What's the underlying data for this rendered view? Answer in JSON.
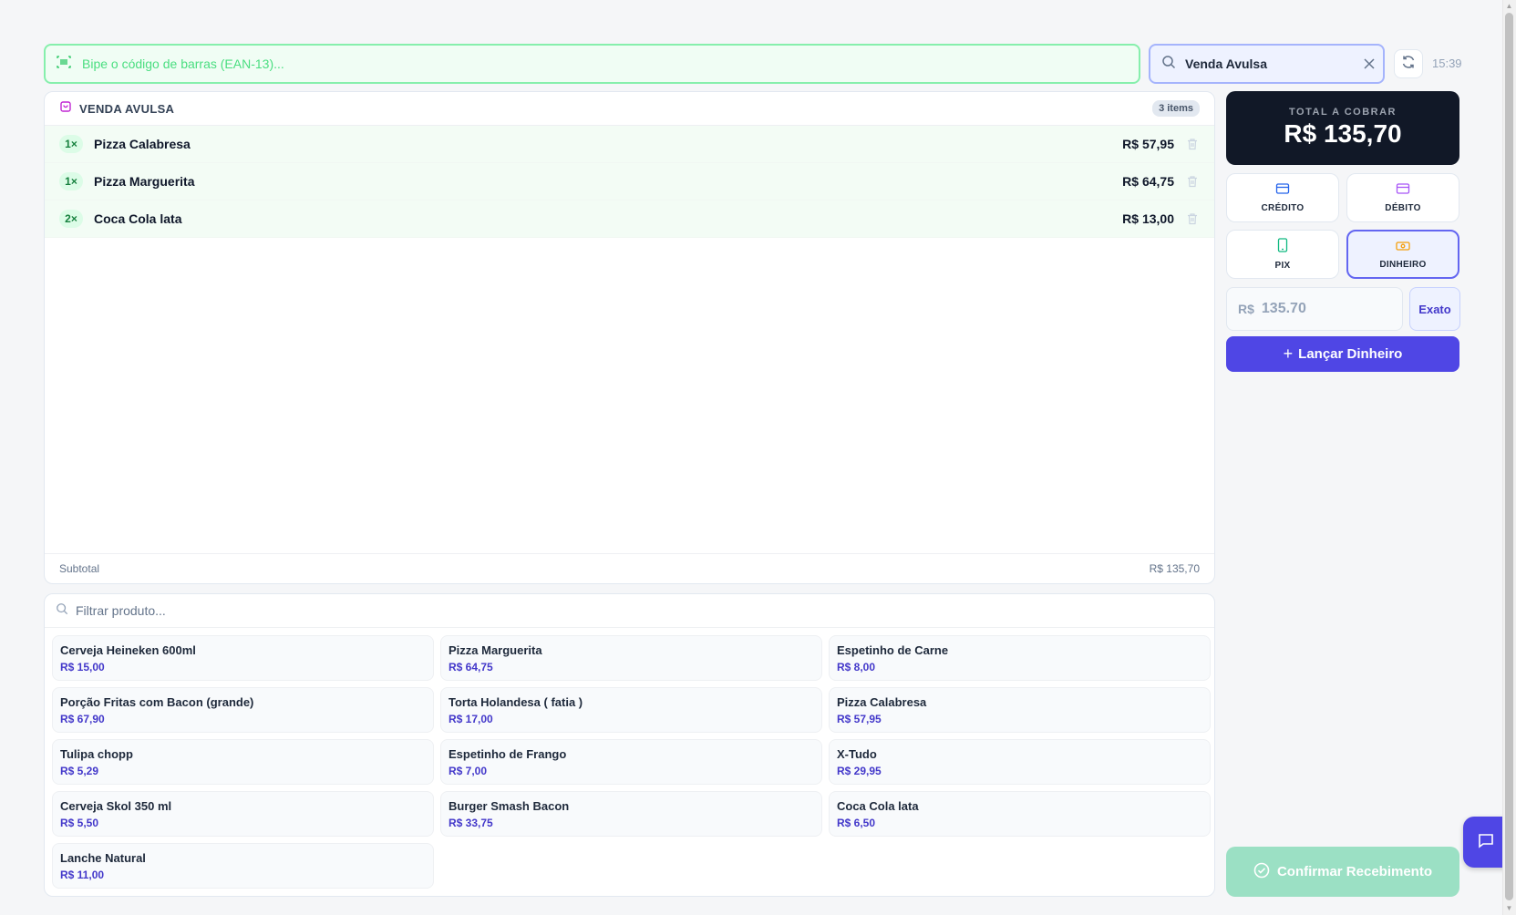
{
  "barcode": {
    "placeholder": "Bipe o código de barras (EAN-13)...",
    "icon": "barcode-scan-icon"
  },
  "client": {
    "value": "Venda Avulsa",
    "icon": "search-icon"
  },
  "clock": "15:39",
  "cart": {
    "title": "VENDA AVULSA",
    "count_label": "3 items",
    "items": [
      {
        "qty": "1×",
        "name": "Pizza Calabresa",
        "price": "R$ 57,95"
      },
      {
        "qty": "1×",
        "name": "Pizza Marguerita",
        "price": "R$ 64,75"
      },
      {
        "qty": "2×",
        "name": "Coca Cola lata",
        "price": "R$ 13,00"
      }
    ],
    "subtotal_label": "Subtotal",
    "subtotal_value": "R$ 135,70"
  },
  "products": {
    "filter_placeholder": "Filtrar produto...",
    "items": [
      {
        "name": "Cerveja Heineken 600ml",
        "price": "R$ 15,00"
      },
      {
        "name": "Pizza Marguerita",
        "price": "R$ 64,75"
      },
      {
        "name": "Espetinho de Carne",
        "price": "R$ 8,00"
      },
      {
        "name": "Porção Fritas com Bacon (grande)",
        "price": "R$ 67,90"
      },
      {
        "name": "Torta Holandesa ( fatia )",
        "price": "R$ 17,00"
      },
      {
        "name": "Pizza Calabresa",
        "price": "R$ 57,95"
      },
      {
        "name": "Tulipa chopp",
        "price": "R$ 5,29"
      },
      {
        "name": "Espetinho de Frango",
        "price": "R$ 7,00"
      },
      {
        "name": "X-Tudo",
        "price": "R$ 29,95"
      },
      {
        "name": "Cerveja Skol 350 ml",
        "price": "R$ 5,50"
      },
      {
        "name": "Burger Smash Bacon",
        "price": "R$ 33,75"
      },
      {
        "name": "Coca Cola lata",
        "price": "R$ 6,50"
      },
      {
        "name": "Lanche Natural",
        "price": "R$ 11,00"
      }
    ]
  },
  "total": {
    "label": "TOTAL A COBRAR",
    "amount": "R$ 135,70"
  },
  "payment": {
    "credito": "CRÉDITO",
    "debito": "DÉBITO",
    "pix": "PIX",
    "dinheiro": "DINHEIRO",
    "selected": "DINHEIRO"
  },
  "cash": {
    "currency": "R$",
    "placeholder": "135.70",
    "exato_label": "Exato",
    "lancar_label": "Lançar Dinheiro"
  },
  "confirm_label": "Confirmar Recebimento",
  "colors": {
    "accent": "#4f46e5",
    "dark": "#111827",
    "success": "#22c55e"
  }
}
